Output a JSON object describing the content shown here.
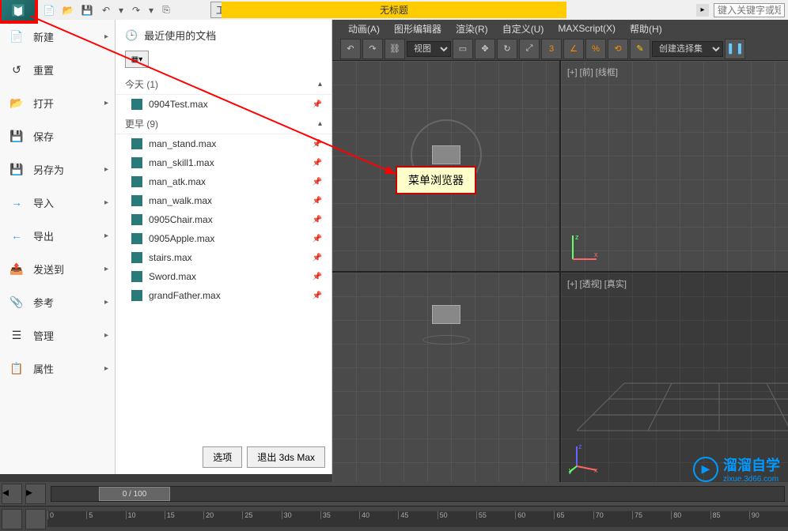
{
  "title": "无标题",
  "search_placeholder": "键入关键字或短语",
  "workspace": "工作区: 默认",
  "menus": {
    "anim": "动画(A)",
    "graph": "图形编辑器",
    "render": "渲染(R)",
    "custom": "自定义(U)",
    "maxscript": "MAXScript(X)",
    "help": "帮助(H)"
  },
  "toolbar": {
    "view_mode": "视图",
    "selection_set": "创建选择集"
  },
  "app_menu": {
    "new": "新建",
    "reset": "重置",
    "open": "打开",
    "save": "保存",
    "save_as": "另存为",
    "import": "导入",
    "export": "导出",
    "send_to": "发送到",
    "reference": "参考",
    "manage": "管理",
    "properties": "属性"
  },
  "recent": {
    "title": "最近使用的文档",
    "today": "今天 (1)",
    "earlier": "更早 (9)",
    "today_files": [
      "0904Test.max"
    ],
    "earlier_files": [
      "man_stand.max",
      "man_skill1.max",
      "man_atk.max",
      "man_walk.max",
      "0905Chair.max",
      "0905Apple.max",
      "stairs.max",
      "Sword.max",
      "grandFather.max"
    ],
    "options": "选项",
    "exit": "退出 3ds Max"
  },
  "viewports": {
    "front": "[+] [前] [线框]",
    "persp": "[+] [透视] [真实]"
  },
  "callout": "菜单浏览器",
  "time": {
    "frame": "0 / 100"
  },
  "watermark": {
    "brand": "溜溜自学",
    "url": "zixue.3d66.com"
  }
}
